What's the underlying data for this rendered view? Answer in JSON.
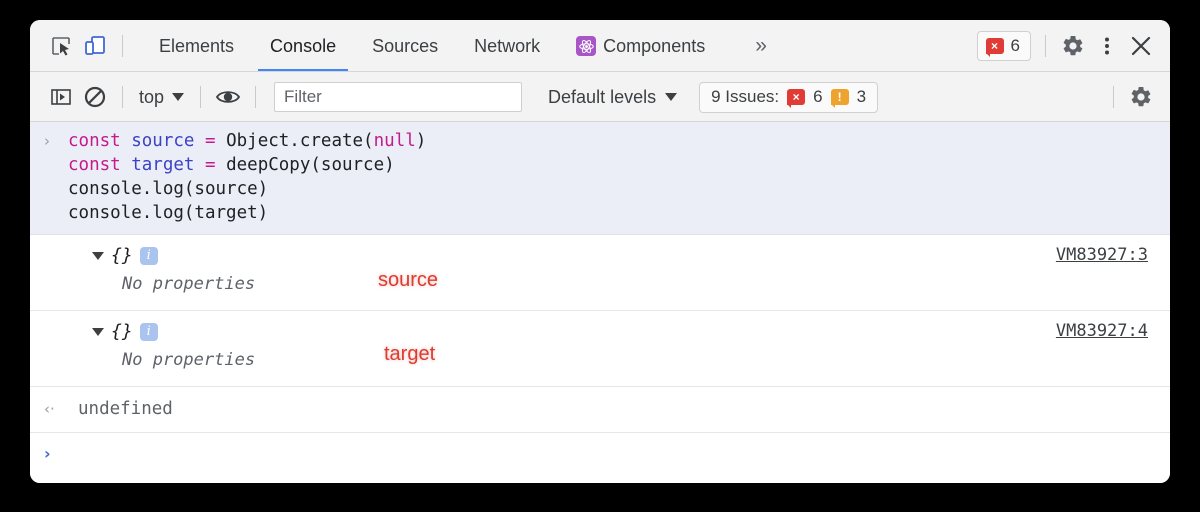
{
  "window": {
    "title": "Chrome DevTools Console"
  },
  "tabbar": {
    "inspect_icon": "inspect-cursor-icon",
    "device_icon": "device-toolbar-icon",
    "tabs": [
      {
        "label": "Elements",
        "active": false,
        "icon": null
      },
      {
        "label": "Console",
        "active": true,
        "icon": null
      },
      {
        "label": "Sources",
        "active": false,
        "icon": null
      },
      {
        "label": "Network",
        "active": false,
        "icon": null
      },
      {
        "label": "Components",
        "active": false,
        "icon": "react-components-icon"
      }
    ],
    "more_tabs_label": "»",
    "error_count": "6",
    "error_badge_glyph": "×",
    "settings_icon": "gear-icon",
    "more_options_icon": "kebab-menu-icon",
    "close_icon": "close-icon"
  },
  "filterbar": {
    "sidebar_toggle_icon": "console-sidebar-icon",
    "clear_console_icon": "clear-console-icon",
    "context_label": "top",
    "eye_icon": "live-expression-eye-icon",
    "filter_placeholder": "Filter",
    "filter_value": "",
    "levels_label": "Default levels",
    "issues_label": "9 Issues:",
    "issues_error_count": "6",
    "issues_warning_count": "3",
    "issues_error_glyph": "×",
    "issues_warning_glyph": "!",
    "settings_icon": "gear-icon"
  },
  "console": {
    "input_prompt_glyph": "›",
    "code_lines": [
      [
        {
          "t": "const",
          "c": "kw"
        },
        {
          "t": " ",
          "c": "plain"
        },
        {
          "t": "source",
          "c": "ident"
        },
        {
          "t": " ",
          "c": "plain"
        },
        {
          "t": "=",
          "c": "op"
        },
        {
          "t": " Object.create(",
          "c": "plain"
        },
        {
          "t": "null",
          "c": "nullkw"
        },
        {
          "t": ")",
          "c": "plain"
        }
      ],
      [
        {
          "t": "const",
          "c": "kw"
        },
        {
          "t": " ",
          "c": "plain"
        },
        {
          "t": "target",
          "c": "ident"
        },
        {
          "t": " ",
          "c": "plain"
        },
        {
          "t": "=",
          "c": "op"
        },
        {
          "t": " deepCopy(source)",
          "c": "plain"
        }
      ],
      [
        {
          "t": "console.log(source)",
          "c": "plain"
        }
      ],
      [
        {
          "t": "console.log(target)",
          "c": "plain"
        }
      ]
    ],
    "output_rows": [
      {
        "object_label": "{}",
        "info_glyph": "i",
        "detail": "No properties",
        "source_link": "VM83927:3",
        "annotation": "source"
      },
      {
        "object_label": "{}",
        "info_glyph": "i",
        "detail": "No properties",
        "source_link": "VM83927:4",
        "annotation": "target"
      }
    ],
    "return_arrow_glyph": "‹·",
    "return_value": "undefined",
    "prompt_glyph": "›"
  },
  "colors": {
    "page_background": "#000000",
    "panel_background": "#ffffff",
    "toolbar_background": "#f3f3f3",
    "active_tab_underline": "#4285f4",
    "code_block_background": "#ebeef7",
    "keyword": "#c41a8c",
    "identifier": "#3b42c4",
    "error_red": "#e03b36",
    "warning_orange": "#eda32e",
    "annotation_red": "#dc3c30",
    "info_badge_blue": "#aac4ef",
    "react_icon_purple": "#a855c8"
  }
}
